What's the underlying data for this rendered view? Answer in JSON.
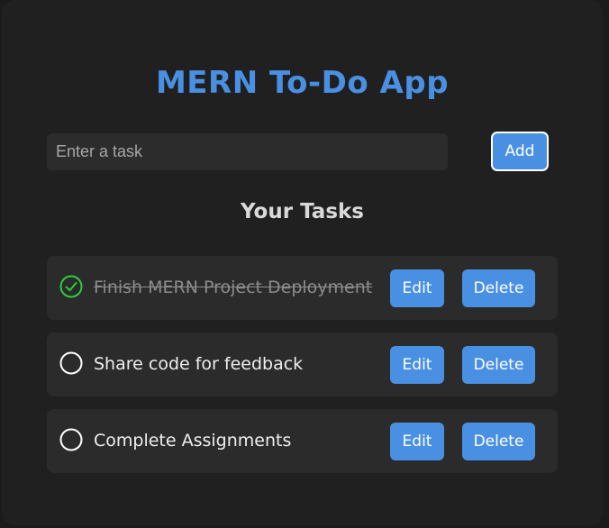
{
  "app": {
    "title": "MERN To-Do App"
  },
  "form": {
    "input_placeholder": "Enter a task",
    "input_value": "",
    "add_label": "Add"
  },
  "tasks_section": {
    "title": "Your Tasks",
    "edit_label": "Edit",
    "delete_label": "Delete",
    "items": [
      {
        "text": "Finish MERN Project Deployment",
        "completed": true
      },
      {
        "text": "Share code for feedback",
        "completed": false
      },
      {
        "text": "Complete Assignments",
        "completed": false
      }
    ]
  },
  "colors": {
    "accent": "#4a90e2",
    "completed_check": "#2ecc40",
    "background": "#202020"
  },
  "icons": {
    "completed": "check-circle-icon",
    "pending": "empty-circle-icon"
  }
}
